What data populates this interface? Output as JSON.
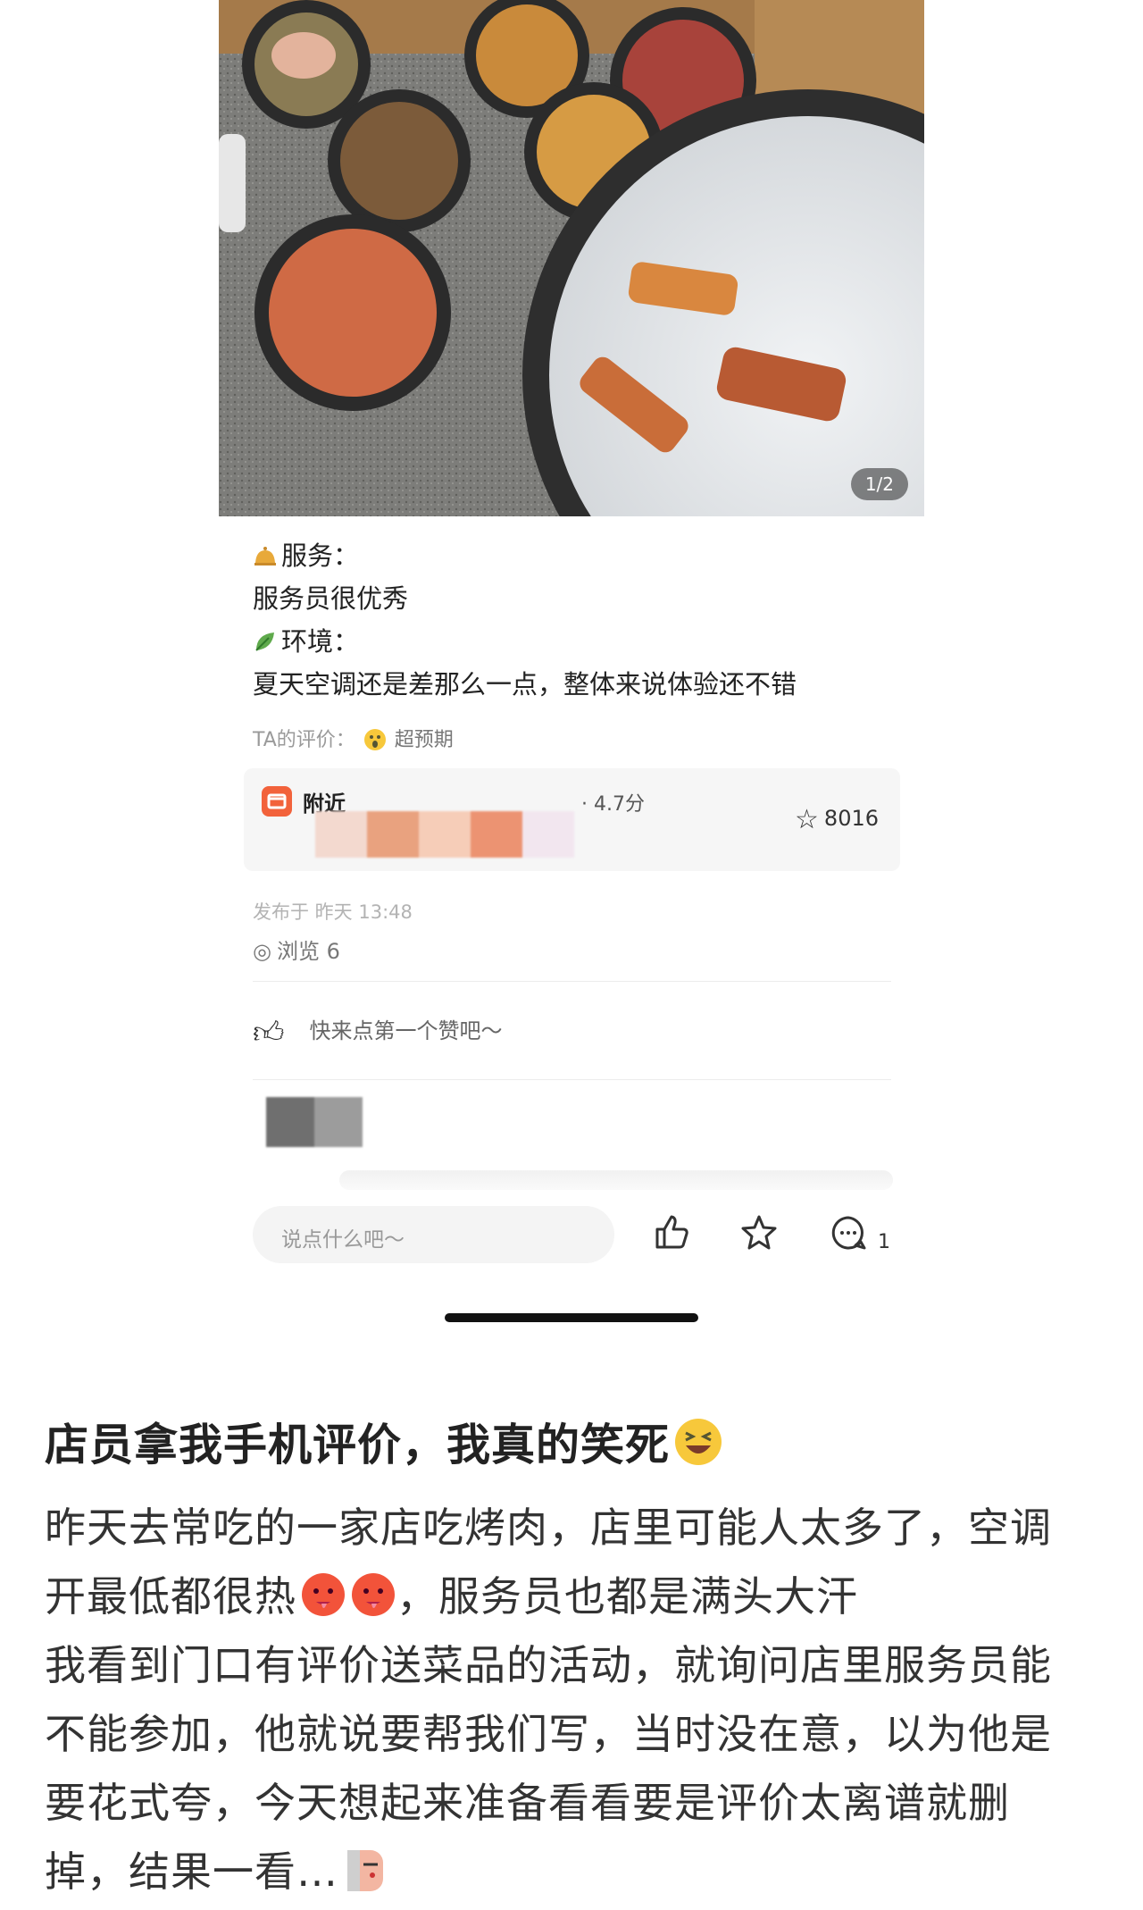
{
  "photo": {
    "page_counter": "1/2"
  },
  "review": {
    "service_heading": "服务：",
    "service_text": "服务员很优秀",
    "env_heading": "环境：",
    "env_text": "夏天空调还是差那么一点，整体来说体验还不错",
    "ta_rating_label": "TA的评价：",
    "ta_rating_value": "超预期"
  },
  "shop": {
    "name": "附近",
    "score": "· 4.7分",
    "favorites": "8016"
  },
  "meta": {
    "published": "发布于 昨天 13:48",
    "views": "浏览 6"
  },
  "interaction": {
    "like_hint": "快来点第一个赞吧～",
    "input_placeholder": "说点什么吧～",
    "comment_count": "1"
  },
  "post": {
    "title": "店员拿我手机评价，我真的笑死",
    "lines": [
      "昨天去常吃的一家店吃烤肉，店里可能人太多了，空调",
      "开最低都很热",
      "，服务员也都是满头大汗",
      "我看到门口有评价送菜品的活动，就询问店里服务员能",
      "不能参加，他就说要帮我们写，当时没在意，以为他是",
      "要花式夸，今天想起来准备看看要是评价太离谱就删",
      "掉，结果一看…"
    ]
  },
  "colors": {
    "shop_logo": "#f2623b",
    "home_indicator": "#111111"
  }
}
